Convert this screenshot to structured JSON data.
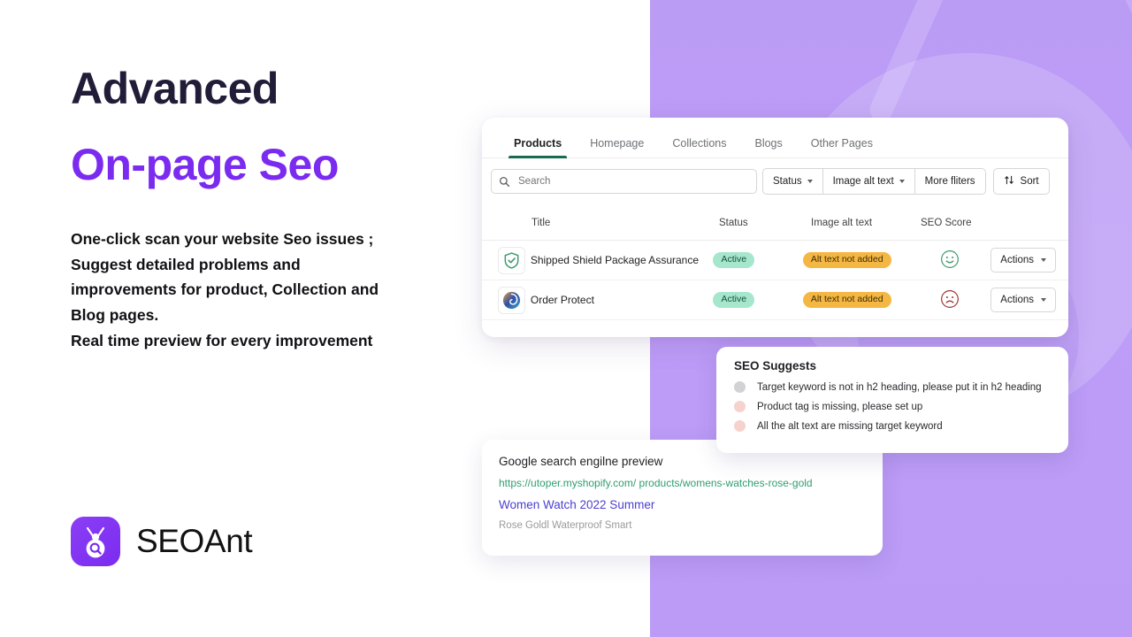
{
  "hero": {
    "headline_line1": "Advanced",
    "headline_line2": "On-page Seo",
    "headline_color": "#7b2bf0",
    "subcopy_lines": [
      "One-click scan your website Seo issues ;",
      "Suggest detailed problems and",
      "improvements for product, Collection and",
      "Blog pages.",
      "Real time preview for every improvement"
    ],
    "brand_name": "SEOAnt"
  },
  "app": {
    "tabs": [
      {
        "label": "Products",
        "active": true
      },
      {
        "label": "Homepage",
        "active": false
      },
      {
        "label": "Collections",
        "active": false
      },
      {
        "label": "Blogs",
        "active": false
      },
      {
        "label": "Other Pages",
        "active": false
      }
    ],
    "search": {
      "placeholder": "Search",
      "value": ""
    },
    "filters": [
      {
        "label": "Status",
        "has_caret": true
      },
      {
        "label": "Image alt text",
        "has_caret": true
      },
      {
        "label": "More fliters",
        "has_caret": false
      }
    ],
    "sort_label": "Sort",
    "table": {
      "columns": [
        "Title",
        "Status",
        "Image alt text",
        "SEO Score"
      ],
      "rows": [
        {
          "icon": "green-shield-check-icon",
          "title": "Shipped Shield Package Assurance",
          "status": "Active",
          "alt_text": "Alt text not added",
          "score_face": "happy",
          "actions_label": "Actions"
        },
        {
          "icon": "blue-swirl-icon",
          "title": "Order Protect",
          "status": "Active",
          "alt_text": "Alt text not added",
          "score_face": "sad",
          "actions_label": "Actions"
        }
      ]
    }
  },
  "seo_suggests": {
    "title": "SEO Suggests",
    "items": [
      {
        "text": "Target keyword is not in h2 heading, please put it in h2 heading",
        "dot_color": "#d2d2d5"
      },
      {
        "text": "Product tag is missing, please set up",
        "dot_color": "#f6d2cd"
      },
      {
        "text": "All the alt text are missing target keyword",
        "dot_color": "#f6d2cd"
      }
    ]
  },
  "google_preview": {
    "title": "Google search engilne preview",
    "url": "https://utoper.myshopify.com/ products/womens-watches-rose-gold",
    "page_title": "Women Watch 2022 Summer",
    "description": "Rose Goldl Waterproof Smart",
    "url_color": "#2f9e6e",
    "title_color": "#4c3ed0"
  },
  "theme": {
    "panel_purple": "#bd9df7",
    "accent_purple": "#7b2bf0",
    "tab_underline_green": "#1a6b4d",
    "badge_active_bg": "#a6e6cd",
    "badge_alt_bg": "#f5b743"
  }
}
